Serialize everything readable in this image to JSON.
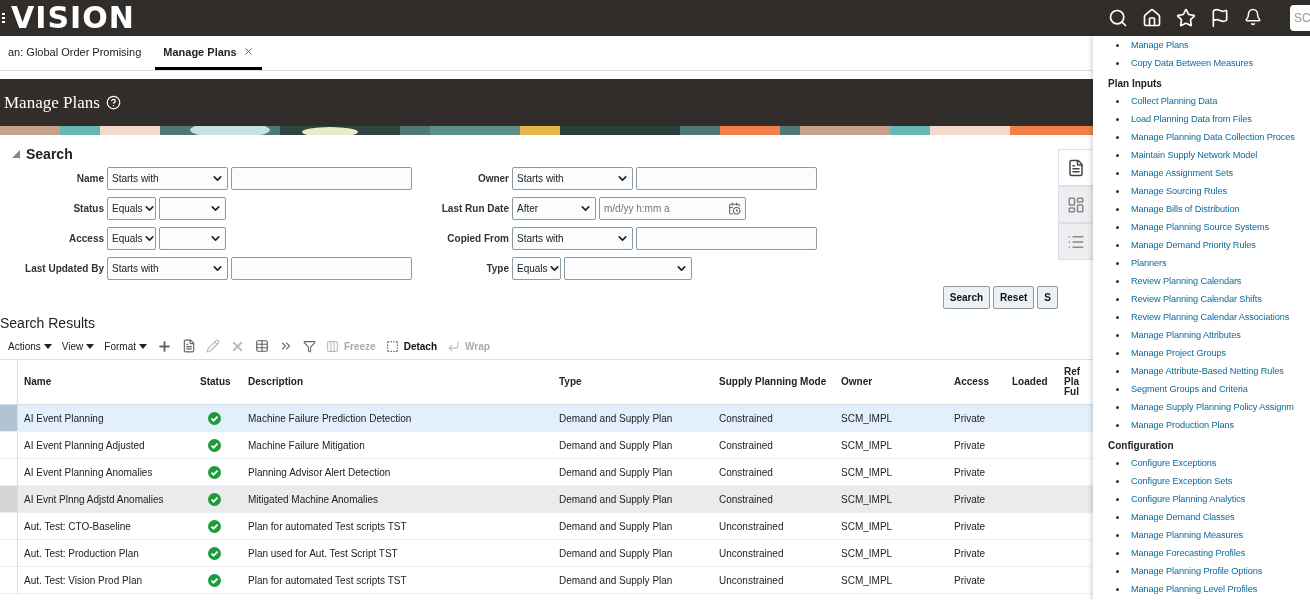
{
  "header": {
    "logo": "VISION",
    "search_placeholder": "SC"
  },
  "tabs": [
    {
      "label": "an: Global Order Promising",
      "selected": false,
      "closable": false
    },
    {
      "label": "Manage Plans",
      "selected": true,
      "closable": true
    }
  ],
  "page_title": "Manage Plans",
  "search": {
    "title": "Search",
    "expanded": true,
    "fields_left": [
      {
        "label": "Name",
        "operator": "Starts with",
        "kind": "text"
      },
      {
        "label": "Status",
        "operator": "Equals",
        "kind": "select"
      },
      {
        "label": "Access",
        "operator": "Equals",
        "kind": "select"
      },
      {
        "label": "Last Updated By",
        "operator": "Starts with",
        "kind": "text"
      }
    ],
    "fields_right": [
      {
        "label": "Owner",
        "operator": "Starts with",
        "kind": "text"
      },
      {
        "label": "Last Run Date",
        "operator": "After",
        "kind": "date",
        "placeholder": "m/d/yy h:mm a"
      },
      {
        "label": "Copied From",
        "operator": "Starts with",
        "kind": "text"
      },
      {
        "label": "Type",
        "operator": "Equals",
        "kind": "select"
      }
    ],
    "buttons": [
      "Search",
      "Reset",
      "S"
    ]
  },
  "side_tabs": [
    {
      "kind": "document",
      "selected": true
    },
    {
      "kind": "dashboard",
      "selected": false
    },
    {
      "kind": "list",
      "selected": false
    }
  ],
  "results": {
    "title": "Search Results",
    "menus": [
      "Actions",
      "View",
      "Format"
    ],
    "tools": [
      {
        "kind": "add",
        "disabled": false
      },
      {
        "kind": "document",
        "disabled": false
      },
      {
        "kind": "edit",
        "disabled": true
      },
      {
        "kind": "delete",
        "disabled": true
      },
      {
        "kind": "table",
        "disabled": false
      },
      {
        "kind": "more",
        "disabled": false
      },
      {
        "kind": "filter",
        "disabled": false
      },
      {
        "kind": "freeze",
        "label": "Freeze",
        "disabled": true
      },
      {
        "kind": "detach",
        "label": "Detach",
        "disabled": false
      },
      {
        "kind": "wrap",
        "label": "Wrap",
        "disabled": true
      }
    ],
    "columns": [
      {
        "label": "Name"
      },
      {
        "label": "Status"
      },
      {
        "label": "Description"
      },
      {
        "label": "Type"
      },
      {
        "label": "Supply Planning Mode"
      },
      {
        "label": "Owner"
      },
      {
        "label": "Access"
      },
      {
        "label": "Loaded"
      },
      {
        "lines": [
          "Ref",
          "Pla",
          "Ful"
        ]
      }
    ],
    "rows": [
      {
        "name": "AI Event Planning",
        "status_ok": true,
        "description": "Machine Failure Prediction Detection",
        "type": "Demand and Supply Plan",
        "mode": "Constrained",
        "owner": "SCM_IMPL",
        "access": "Private",
        "selected": true,
        "hovered": false
      },
      {
        "name": "AI Event Planning Adjusted",
        "status_ok": true,
        "description": "Machine Failure Mitigation",
        "type": "Demand and Supply Plan",
        "mode": "Constrained",
        "owner": "SCM_IMPL",
        "access": "Private",
        "selected": false,
        "hovered": false
      },
      {
        "name": "AI Event Planning Anomalies",
        "status_ok": true,
        "description": "Planning Advisor Alert Detection",
        "type": "Demand and Supply Plan",
        "mode": "Constrained",
        "owner": "SCM_IMPL",
        "access": "Private",
        "selected": false,
        "hovered": false
      },
      {
        "name": "AI Evnt Plnng Adjstd Anomalies",
        "status_ok": true,
        "description": "Mitigated Machine Anomalies",
        "type": "Demand and Supply Plan",
        "mode": "Constrained",
        "owner": "SCM_IMPL",
        "access": "Private",
        "selected": false,
        "hovered": true
      },
      {
        "name": "Aut. Test: CTO-Baseline",
        "status_ok": true,
        "description": "Plan for automated Test scripts TST",
        "type": "Demand and Supply Plan",
        "mode": "Unconstrained",
        "owner": "SCM_IMPL",
        "access": "Private",
        "selected": false,
        "hovered": false
      },
      {
        "name": "Aut. Test: Production Plan",
        "status_ok": true,
        "description": "Plan used for Aut. Test Script TST",
        "type": "Demand and Supply Plan",
        "mode": "Unconstrained",
        "owner": "SCM_IMPL",
        "access": "Private",
        "selected": false,
        "hovered": false
      },
      {
        "name": "Aut. Test: Vision Prod Plan",
        "status_ok": true,
        "description": "Plan for automated Test scripts TST",
        "type": "Demand and Supply Plan",
        "mode": "Unconstrained",
        "owner": "SCM_IMPL",
        "access": "Private",
        "selected": false,
        "hovered": false
      }
    ]
  },
  "task_panel": {
    "sections": [
      {
        "items": [
          "Manage Plans",
          "Copy Data Between Measures"
        ]
      },
      {
        "title": "Plan Inputs",
        "items": [
          "Collect Planning Data",
          "Load Planning Data from Files",
          "Manage Planning Data Collection Proces",
          "Maintain Supply Network Model",
          "Manage Assignment Sets",
          "Manage Sourcing Rules",
          "Manage Bills of Distribution",
          "Manage Planning Source Systems",
          "Manage Demand Priority Rules",
          "Planners",
          "Review Planning Calendars",
          "Review Planning Calendar Shifts",
          "Review Planning Calendar Associations",
          "Manage Planning Attributes",
          "Manage Project Groups",
          "Manage Attribute-Based Netting Rules",
          "Segment Groups and Criteria",
          "Manage Supply Planning Policy Assignm",
          "Manage Production Plans"
        ]
      },
      {
        "title": "Configuration",
        "items": [
          "Configure Exceptions",
          "Configure Exception Sets",
          "Configure Planning Analytics",
          "Manage Demand Classes",
          "Manage Planning Measures",
          "Manage Forecasting Profiles",
          "Manage Planning Profile Options",
          "Manage Planning Level Profiles"
        ]
      }
    ]
  }
}
